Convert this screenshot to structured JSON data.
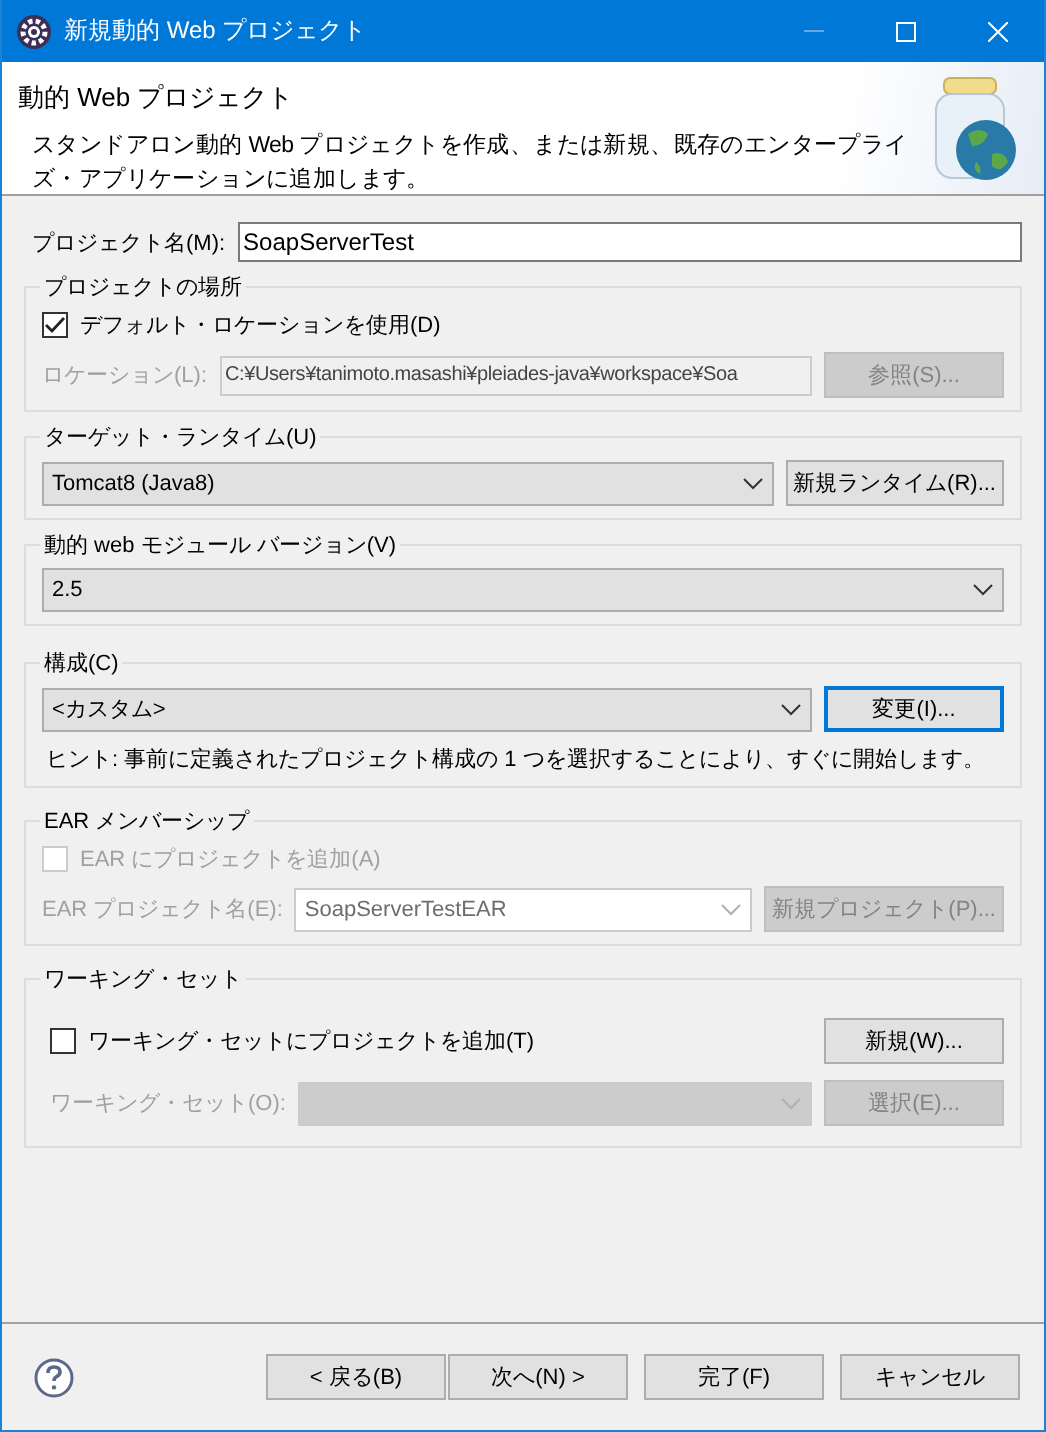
{
  "window": {
    "title": "新規動的 Web プロジェクト"
  },
  "header": {
    "title": "動的 Web プロジェクト",
    "description": "スタンドアロン動的 Web プロジェクトを作成、または新規、既存のエンタープライズ・アプリケーションに追加します。"
  },
  "project_name": {
    "label": "プロジェクト名(M):",
    "value": "SoapServerTest"
  },
  "location": {
    "legend": "プロジェクトの場所",
    "use_default": {
      "label": "デフォルト・ロケーションを使用(D)",
      "checked": true,
      "disabled": false
    },
    "field": {
      "label": "ロケーション(L):",
      "value": "C:¥Users¥tanimoto.masashi¥pleiades-java¥workspace¥Soa",
      "disabled": true
    },
    "button": {
      "label": "参照(S)...",
      "disabled": true,
      "focused": false
    }
  },
  "target_runtime": {
    "legend": "ターゲット・ランタイム(U)",
    "value": "Tomcat8 (Java8)",
    "button": {
      "label": "新規ランタイム(R)...",
      "disabled": false,
      "focused": false
    }
  },
  "module_version": {
    "legend": "動的 web モジュール バージョン(V)",
    "value": "2.5"
  },
  "configuration": {
    "legend": "構成(C)",
    "value": "<カスタム>",
    "button": {
      "label": "変更(I)...",
      "disabled": false,
      "focused": true
    },
    "hint": "ヒント: 事前に定義されたプロジェクト構成の 1 つを選択することにより、すぐに開始します。"
  },
  "ear": {
    "legend": "EAR メンバーシップ",
    "add": {
      "label": "EAR にプロジェクトを追加(A)",
      "checked": false,
      "disabled": true
    },
    "field": {
      "label": "EAR プロジェクト名(E):",
      "value": "SoapServerTestEAR",
      "disabled": true
    },
    "button": {
      "label": "新規プロジェクト(P)...",
      "disabled": true,
      "focused": false
    }
  },
  "working_set": {
    "legend": "ワーキング・セット",
    "add": {
      "label": "ワーキング・セットにプロジェクトを追加(T)",
      "checked": false,
      "disabled": false
    },
    "new_button": {
      "label": "新規(W)...",
      "disabled": false,
      "focused": false
    },
    "field": {
      "label": "ワーキング・セット(O):",
      "disabled": true
    },
    "select_button": {
      "label": "選択(E)...",
      "disabled": true,
      "focused": false
    }
  },
  "buttons": [
    {
      "label": "< 戻る(B)",
      "disabled": false
    },
    {
      "label": "次へ(N) >",
      "disabled": false
    },
    {
      "label": "完了(F)",
      "disabled": false
    },
    {
      "label": "キャンセル",
      "disabled": false
    }
  ]
}
